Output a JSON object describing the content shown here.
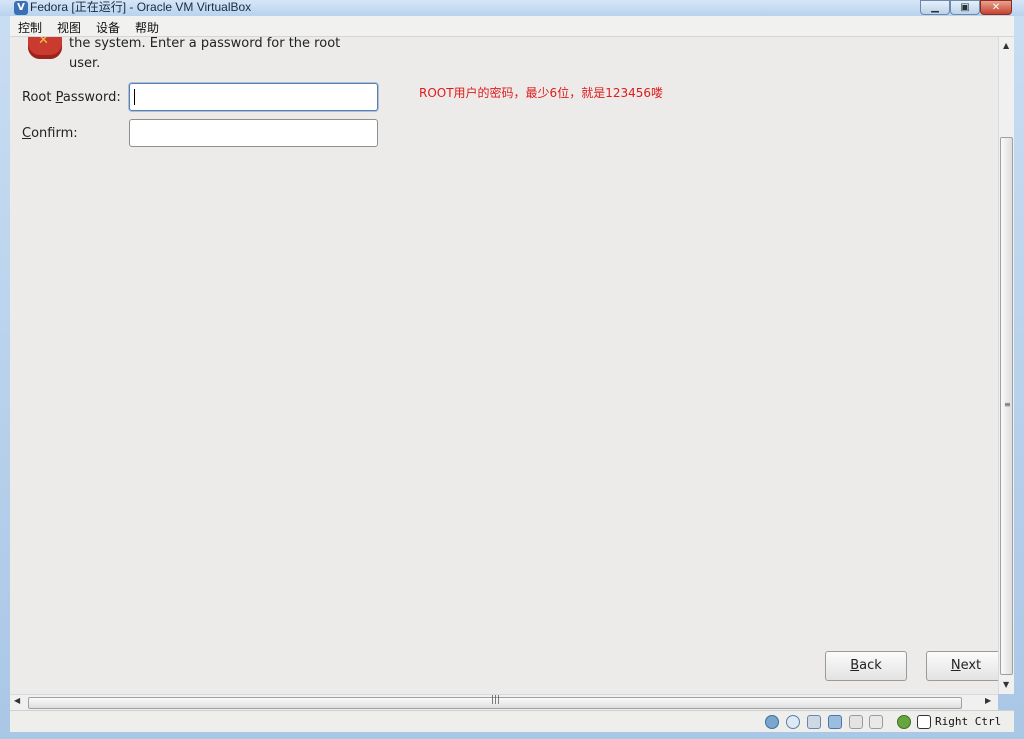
{
  "window": {
    "title": "Fedora [正在运行] - Oracle VM VirtualBox",
    "app_icon": "virtualbox-icon",
    "controls": {
      "minimize": "▁",
      "maximize": "▣",
      "close": "✕"
    }
  },
  "menubar": {
    "items": [
      "控制",
      "视图",
      "设备",
      "帮助"
    ]
  },
  "installer": {
    "description_line1": "the system.  Enter a password for the root",
    "description_line2": "user.",
    "root_password_label_pre": "Root ",
    "root_password_label_key": "P",
    "root_password_label_post": "assword:",
    "root_password_value": "",
    "confirm_label_key": "C",
    "confirm_label_post": "onfirm:",
    "confirm_value": "",
    "annotation": "ROOT用户的密码，最少6位，就是123456喽",
    "annotation_color": "#e01b1b",
    "back_key": "B",
    "back_rest": "ack",
    "next_key": "N",
    "next_rest": "ext"
  },
  "statusbar": {
    "icons": [
      "hard-disk-icon",
      "optical-drive-icon",
      "usb-icon",
      "network-icon",
      "shared-folders-icon",
      "display-icon",
      "virtualization-icon",
      "mouse-integration-icon"
    ],
    "host_key": "Right Ctrl"
  }
}
